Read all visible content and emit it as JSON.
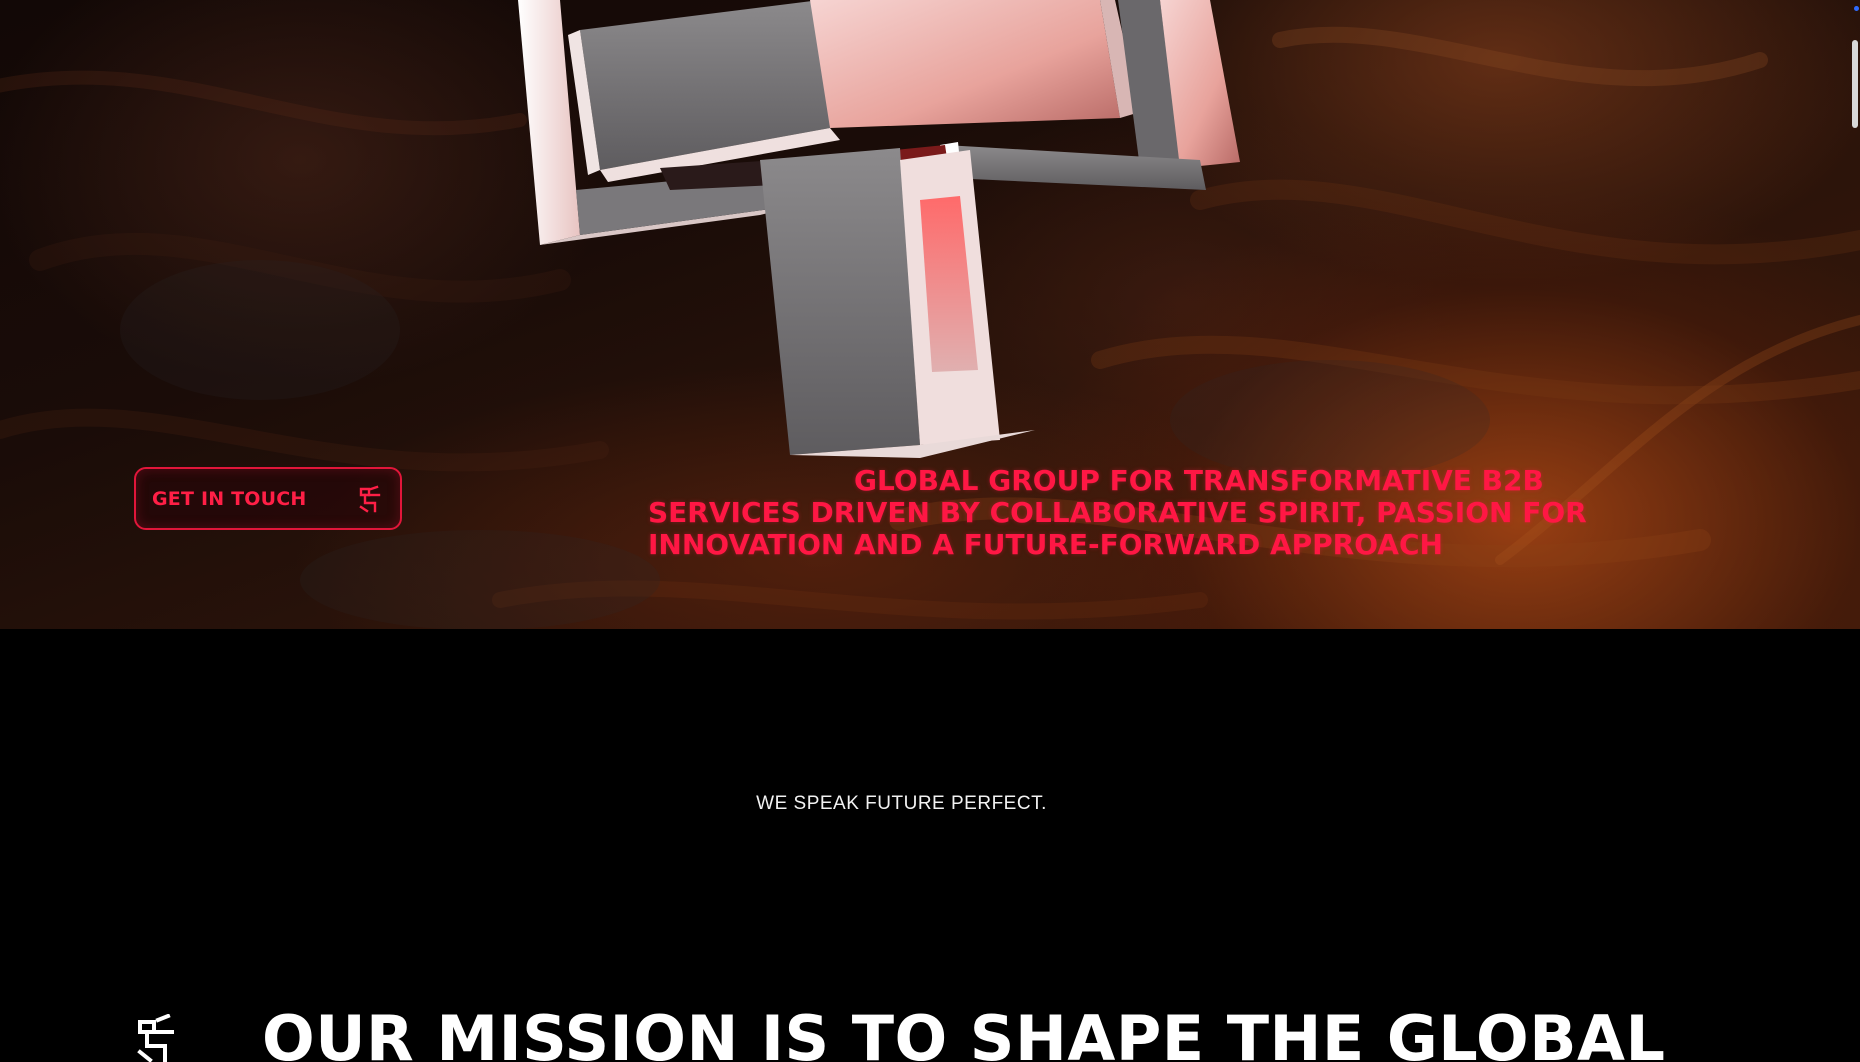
{
  "hero": {
    "cta": {
      "label": "GET IN TOUCH",
      "icon": "brand-mark-icon"
    },
    "tagline": {
      "line1": "GLOBAL GROUP FOR TRANSFORMATIVE B2B",
      "line2": "SERVICES DRIVEN BY COLLABORATIVE SPIRIT, PASSION FOR",
      "line3": "INNOVATION AND A FUTURE-FORWARD APPROACH"
    },
    "sculpture": "abstract-3d-logo-sculpture"
  },
  "motto": "WE SPEAK FUTURE PERFECT.",
  "mission": {
    "icon": "brand-mark-icon",
    "heading": "OUR MISSION IS TO SHAPE THE GLOBAL"
  },
  "colors": {
    "accent": "#ff1744",
    "background": "#000000",
    "text": "#ffffff"
  }
}
